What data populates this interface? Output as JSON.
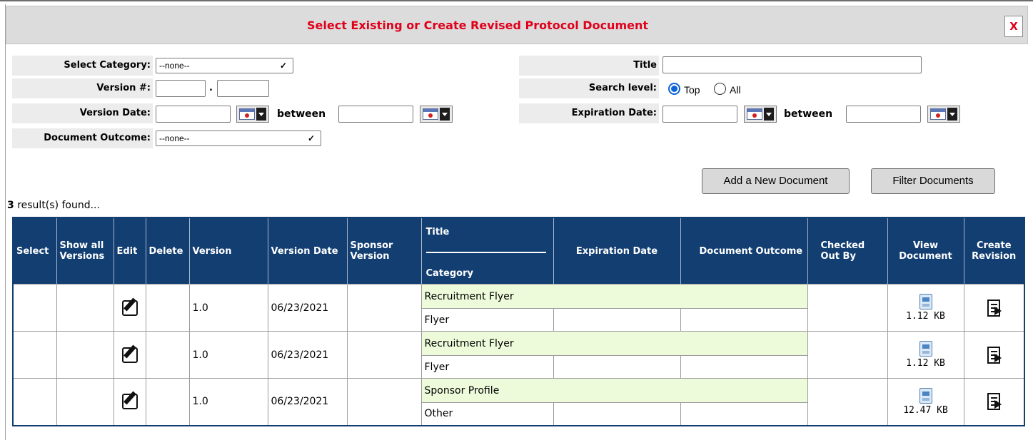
{
  "dialog": {
    "title": "Select Existing or Create Revised Protocol Document",
    "close_label": "X"
  },
  "filters": {
    "category_label": "Select Category:",
    "category_value": "--none--",
    "version_label": "Version #:",
    "version_sep": ".",
    "version_date_label": "Version Date:",
    "between_label": "between",
    "outcome_label": "Document Outcome:",
    "outcome_value": "--none--",
    "title_label": "Title",
    "search_level_label": "Search level:",
    "search_level_options": [
      "Top",
      "All"
    ],
    "search_level_selected": "Top",
    "expiration_label": "Expiration Date:"
  },
  "actions": {
    "add_label": "Add a New Document",
    "filter_label": "Filter Documents"
  },
  "results": {
    "count": "3",
    "suffix": " result(s) found..."
  },
  "table": {
    "headers": {
      "select": "Select",
      "show_all": "Show all Versions",
      "edit": "Edit",
      "delete": "Delete",
      "version": "Version",
      "version_date": "Version Date",
      "sponsor_version": "Sponsor Version",
      "title": "Title",
      "category": "Category",
      "expiration_date": "Expiration Date",
      "document_outcome": "Document Outcome",
      "checked_out_by": "Checked Out By",
      "view_document": "View Document",
      "create_revision": "Create Revision"
    },
    "rows": [
      {
        "version": "1.0",
        "version_date": "06/23/2021",
        "title": "Recruitment Flyer",
        "category": "Flyer",
        "size": "1.12 KB",
        "doc_icon": "rtf-document-icon"
      },
      {
        "version": "1.0",
        "version_date": "06/23/2021",
        "title": "Recruitment Flyer",
        "category": "Flyer",
        "size": "1.12 KB",
        "doc_icon": "rtf-document-icon"
      },
      {
        "version": "1.0",
        "version_date": "06/23/2021",
        "title": "Sponsor Profile",
        "category": "Other",
        "size": "12.47 KB",
        "doc_icon": "word-document-icon"
      }
    ]
  },
  "colors": {
    "title_red": "#e0001b",
    "header_navy": "#123e72",
    "title_green": "#eefbdb"
  }
}
